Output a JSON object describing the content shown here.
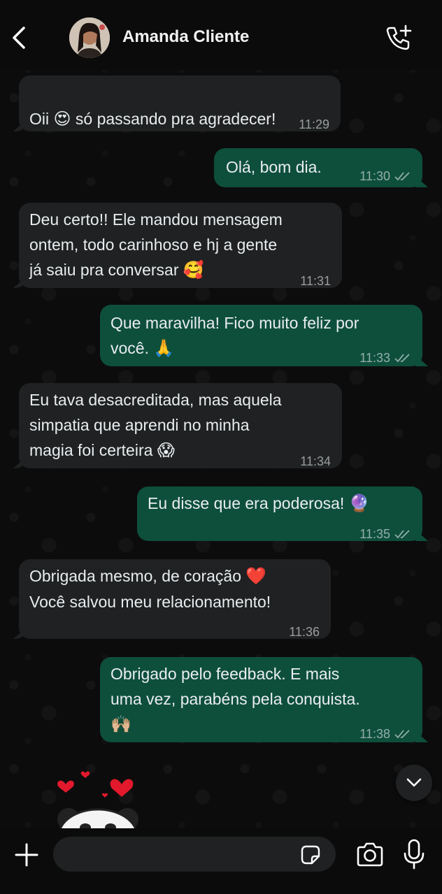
{
  "header": {
    "contact_name": "Amanda Cliente"
  },
  "messages": [
    {
      "direction": "in",
      "text_parts": [
        "Oii ",
        " só passando pra agradecer!"
      ],
      "emoji": "😍",
      "time": "11:29"
    },
    {
      "direction": "out",
      "text": "Olá, bom dia.",
      "time": "11:30",
      "status": "read"
    },
    {
      "direction": "in",
      "text": "Deu certo!! Ele mandou mensagem\nontem, todo carinhoso e hj a gente\njá saiu pra conversar ",
      "emoji": "🥰",
      "time": "11:31"
    },
    {
      "direction": "out",
      "text": "Que maravilha! Fico muito feliz por\nvocê. ",
      "emoji": "🙏",
      "time": "11:33",
      "status": "read"
    },
    {
      "direction": "in",
      "text": "Eu tava desacreditada, mas aquela\nsimpatia que aprendi no minha\nmagia foi certeira ",
      "emoji": "😱",
      "time": "11:34"
    },
    {
      "direction": "out",
      "text": "Eu disse que era poderosa! ",
      "emoji": "🔮",
      "time": "11:35",
      "status": "read"
    },
    {
      "direction": "in",
      "text": "Obrigada mesmo, de coração ",
      "emoji": "❤️",
      "text2": "Você salvou meu relacionamento!",
      "time": "11:36"
    },
    {
      "direction": "out",
      "text": "Obrigado pelo feedback. E mais\numa vez, parabéns pela conquista.\n",
      "emoji": "🙌🏼",
      "time": "11:38",
      "status": "read"
    }
  ],
  "composer": {
    "placeholder": ""
  },
  "icons": {
    "back": "chevron-left-icon",
    "call": "phone-plus-icon",
    "scroll": "chevron-down-icon",
    "plus": "plus-icon",
    "sticker": "sticker-icon",
    "camera": "camera-icon",
    "mic": "microphone-icon"
  },
  "colors": {
    "incoming_bubble": "#1f2122",
    "outgoing_bubble": "#0e4f3c",
    "background": "#0b0b0b"
  }
}
